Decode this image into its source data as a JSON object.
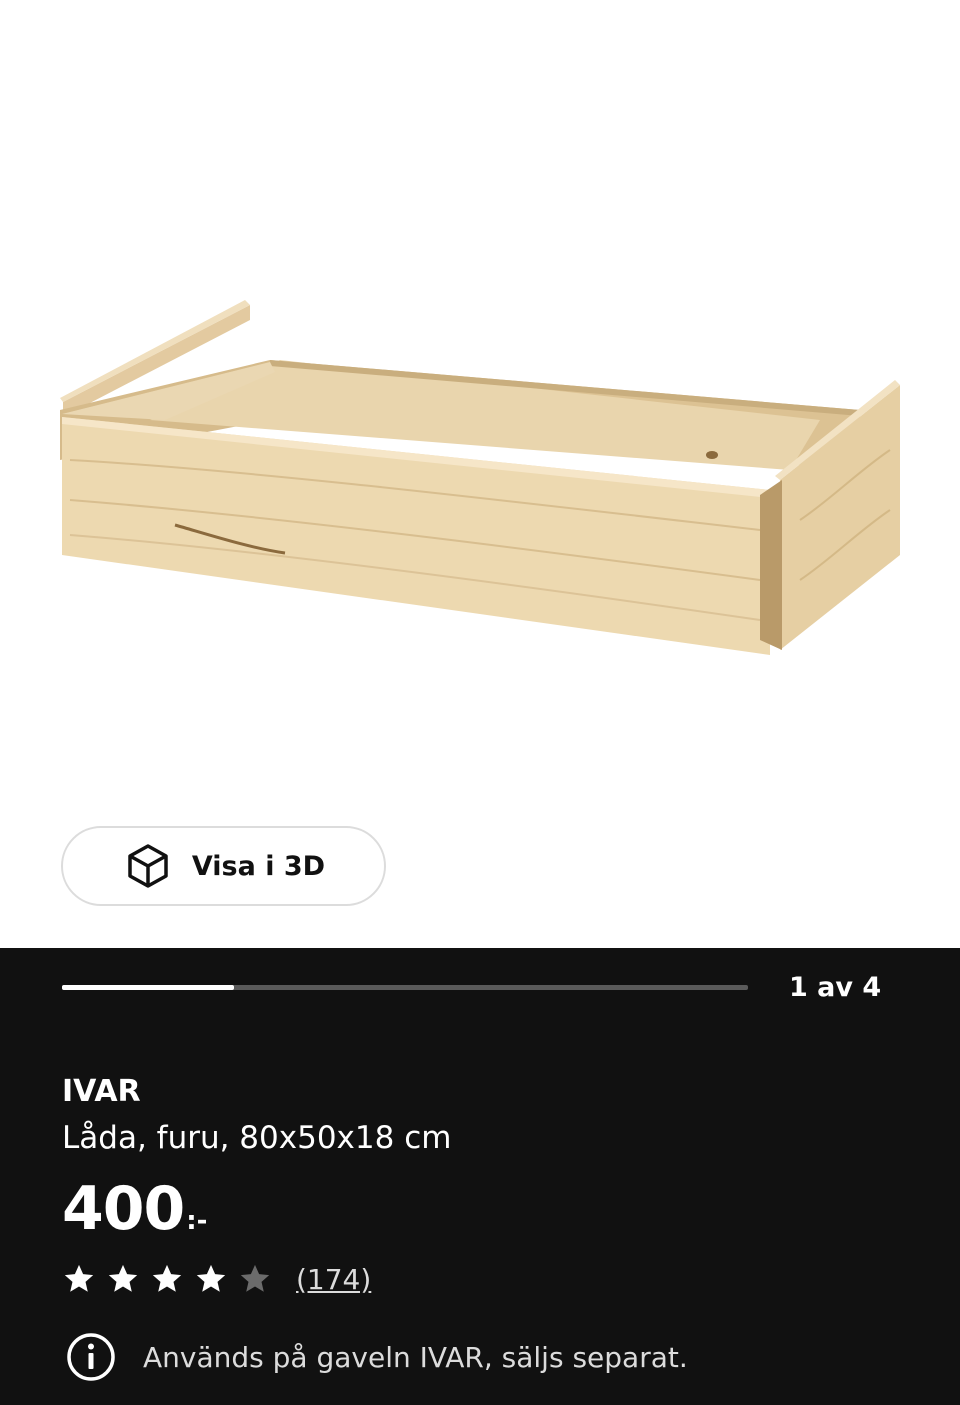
{
  "media": {
    "view_3d_label": "Visa i 3D",
    "progress_fraction": 0.25,
    "pager_text": "1 av 4"
  },
  "product": {
    "name": "IVAR",
    "description": "Låda, furu, 80x50x18 cm",
    "price_integer": "400",
    "price_suffix": ":-",
    "rating": 4,
    "rating_max": 5,
    "review_count": "(174)",
    "note": "Används på gaveln IVAR, säljs separat."
  },
  "colors": {
    "panel_background": "#111111",
    "star_filled": "#ffffff",
    "star_empty": "#6b6b6b",
    "wood": "#e8d2a4"
  },
  "icons": [
    "cube-3d-icon",
    "star-icon",
    "info-icon"
  ]
}
